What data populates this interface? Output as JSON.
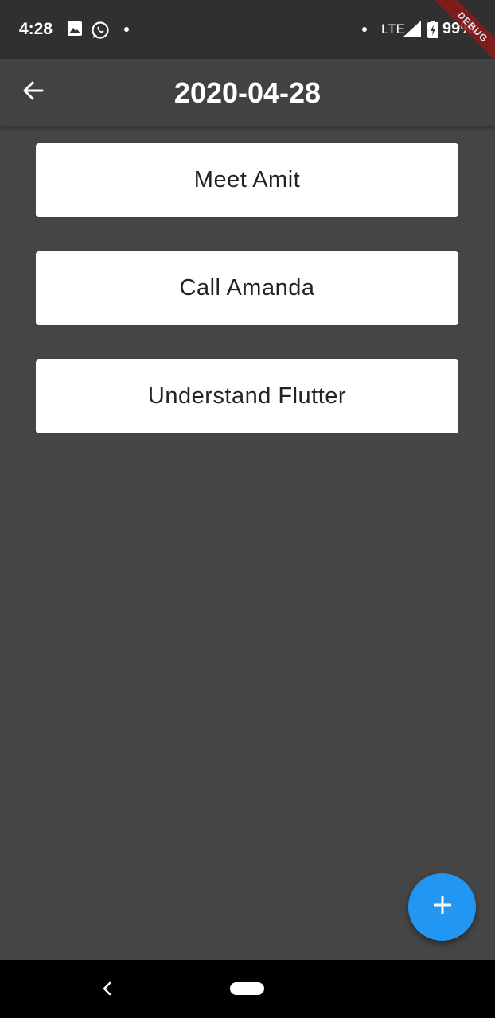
{
  "status_bar": {
    "time": "4:28",
    "network": "LTE",
    "battery": "99%",
    "icons": [
      "gallery-icon",
      "whatsapp-icon",
      "notification-dot-icon",
      "signal-icon",
      "battery-charging-icon"
    ]
  },
  "debug_banner": {
    "label": "DEBUG"
  },
  "app_bar": {
    "title": "2020-04-28",
    "back_icon": "arrow-back-icon"
  },
  "tasks": [
    {
      "label": "Meet Amit"
    },
    {
      "label": "Call Amanda"
    },
    {
      "label": "Understand Flutter"
    }
  ],
  "fab": {
    "icon": "plus-icon",
    "color": "#2196f3"
  },
  "nav_bar": {
    "icons": [
      "nav-back-icon",
      "nav-home-pill"
    ]
  },
  "colors": {
    "background": "#454545",
    "app_bar": "#424242",
    "status_bar": "#303030",
    "card": "#ffffff",
    "accent": "#2196f3"
  }
}
